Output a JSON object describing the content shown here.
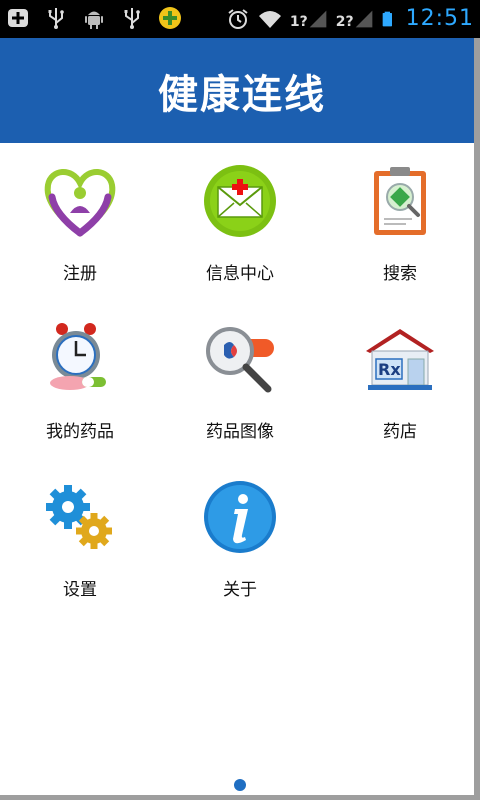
{
  "status": {
    "time": "12:51",
    "sim1": "1?",
    "sim2": "2?",
    "left_icons": [
      "add-box-icon",
      "usb-icon",
      "android-debug-icon",
      "usb-icon",
      "plus-circle-icon"
    ],
    "right_icons": [
      "alarm-icon",
      "wifi-icon",
      "signal-icon",
      "signal-icon",
      "battery-icon"
    ]
  },
  "header": {
    "title": "健康连线"
  },
  "tiles": [
    {
      "label": "注册",
      "icon": "heart-person-icon"
    },
    {
      "label": "信息中心",
      "icon": "mail-icon"
    },
    {
      "label": "搜索",
      "icon": "clipboard-search-icon"
    },
    {
      "label": "我的药品",
      "icon": "alarm-clock-pills-icon"
    },
    {
      "label": "药品图像",
      "icon": "magnifier-pill-icon"
    },
    {
      "label": "药店",
      "icon": "pharmacy-store-icon"
    },
    {
      "label": "设置",
      "icon": "gears-icon"
    },
    {
      "label": "关于",
      "icon": "info-icon"
    }
  ],
  "colors": {
    "header_bg": "#1c5fb0",
    "time_color": "#2ea9ff",
    "page_indicator": "#1f6ec2"
  },
  "pager": {
    "current_page": 1
  }
}
